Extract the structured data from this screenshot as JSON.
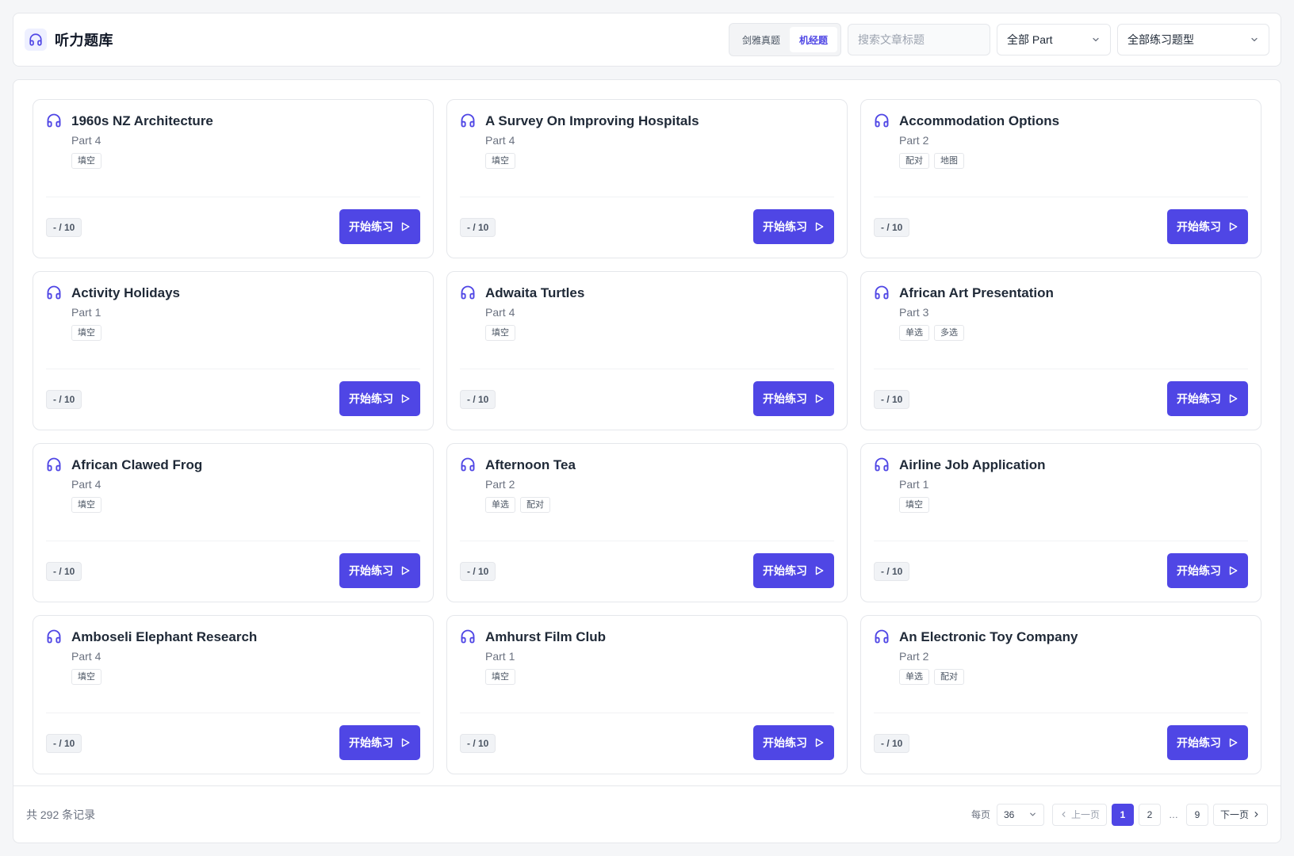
{
  "app": {
    "title": "听力题库",
    "icon": "headphones-icon",
    "accent": "#4f46e5"
  },
  "filters": {
    "source_tabs": [
      {
        "label": "剑雅真题",
        "active": false
      },
      {
        "label": "机经题",
        "active": true
      }
    ],
    "search": {
      "placeholder": "搜索文章标题",
      "value": ""
    },
    "part_select": "全部 Part",
    "type_select": "全部练习题型"
  },
  "cards": [
    {
      "title": "1960s NZ Architecture",
      "part": "Part 4",
      "tags": [
        "填空"
      ],
      "score": "- / 10",
      "action": "开始练习"
    },
    {
      "title": "A Survey On Improving Hospitals",
      "part": "Part 4",
      "tags": [
        "填空"
      ],
      "score": "- / 10",
      "action": "开始练习"
    },
    {
      "title": "Accommodation Options",
      "part": "Part 2",
      "tags": [
        "配对",
        "地图"
      ],
      "score": "- / 10",
      "action": "开始练习"
    },
    {
      "title": "Activity Holidays",
      "part": "Part 1",
      "tags": [
        "填空"
      ],
      "score": "- / 10",
      "action": "开始练习"
    },
    {
      "title": "Adwaita Turtles",
      "part": "Part 4",
      "tags": [
        "填空"
      ],
      "score": "- / 10",
      "action": "开始练习"
    },
    {
      "title": "African Art Presentation",
      "part": "Part 3",
      "tags": [
        "单选",
        "多选"
      ],
      "score": "- / 10",
      "action": "开始练习"
    },
    {
      "title": "African Clawed Frog",
      "part": "Part 4",
      "tags": [
        "填空"
      ],
      "score": "- / 10",
      "action": "开始练习"
    },
    {
      "title": "Afternoon Tea",
      "part": "Part 2",
      "tags": [
        "单选",
        "配对"
      ],
      "score": "- / 10",
      "action": "开始练习"
    },
    {
      "title": "Airline Job Application",
      "part": "Part 1",
      "tags": [
        "填空"
      ],
      "score": "- / 10",
      "action": "开始练习"
    },
    {
      "title": "Amboseli Elephant Research",
      "part": "Part 4",
      "tags": [
        "填空"
      ],
      "score": "- / 10",
      "action": "开始练习"
    },
    {
      "title": "Amhurst Film Club",
      "part": "Part 1",
      "tags": [
        "填空"
      ],
      "score": "- / 10",
      "action": "开始练习"
    },
    {
      "title": "An Electronic Toy Company",
      "part": "Part 2",
      "tags": [
        "单选",
        "配对"
      ],
      "score": "- / 10",
      "action": "开始练习"
    }
  ],
  "footer": {
    "total": "共 292 条记录",
    "per_page_label": "每页",
    "per_page_value": "36",
    "prev": "上一页",
    "next": "下一页",
    "pages": [
      "1",
      "2",
      "…",
      "9"
    ],
    "current_page": "1"
  }
}
